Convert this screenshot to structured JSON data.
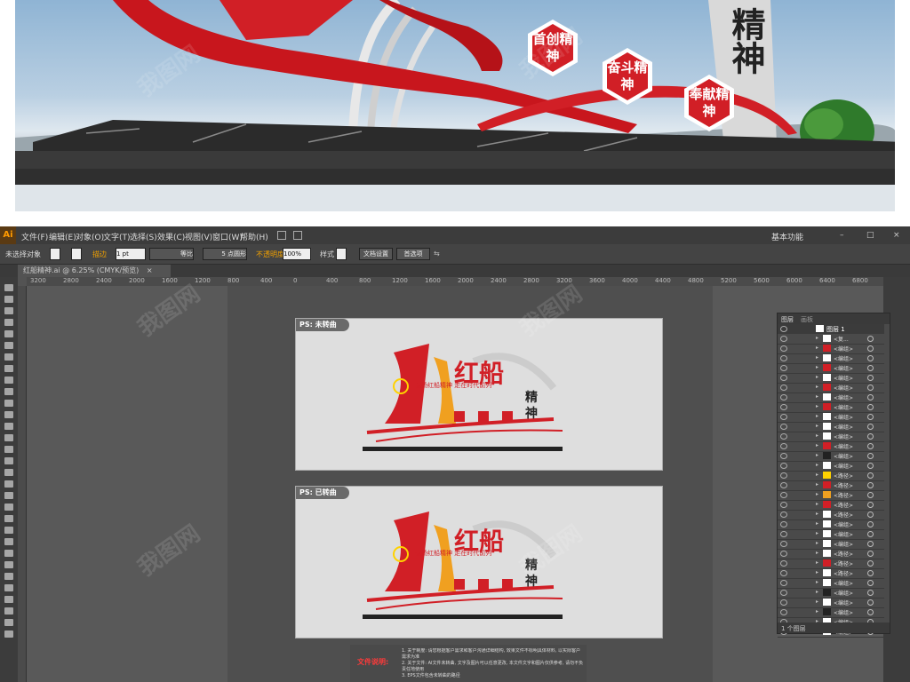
{
  "scene": {
    "hex_badges": [
      "首创精神",
      "奋斗精神",
      "奉献精神"
    ],
    "pillar_text": "精神",
    "colors": {
      "red": "#d11f26",
      "marble": "#2a2a2a"
    }
  },
  "app": {
    "logo": "Ai",
    "menus": [
      "文件(F)",
      "编辑(E)",
      "对象(O)",
      "文字(T)",
      "选择(S)",
      "效果(C)",
      "视图(V)",
      "窗口(W)",
      "帮助(H)"
    ],
    "workspace": "基本功能"
  },
  "control_bar": {
    "selection": "未选择对象",
    "stroke_label": "描边",
    "stroke_weight": "1 pt",
    "stroke_style": "等比",
    "brush": "5 点圆形",
    "opacity_label": "不透明度",
    "opacity": "100%",
    "style_label": "样式",
    "doc_setup": "文档设置",
    "preferences": "首选项"
  },
  "document_tab": "红船精神.ai @ 6.25% (CMYK/预览)",
  "ruler_ticks": [
    "3200",
    "2800",
    "2400",
    "2000",
    "1600",
    "1200",
    "800",
    "400",
    "0",
    "400",
    "800",
    "1200",
    "1600",
    "2000",
    "2400",
    "2800",
    "3200",
    "3600",
    "4000",
    "4400",
    "4800",
    "5200",
    "5600",
    "6000",
    "6400",
    "6800"
  ],
  "artboards": [
    {
      "label": "PS: 未转曲"
    },
    {
      "label": "PS: 已转曲"
    }
  ],
  "design_text": {
    "title_red": "红船",
    "subtitle": "精神",
    "slogan": "弘扬红船精神 走在时代前列"
  },
  "layers_panel": {
    "tabs": [
      "图层",
      "画板"
    ],
    "top_layer": "图层 1",
    "rows": [
      "<复...",
      "<编组>",
      "<编组>",
      "<编组>",
      "<编组>",
      "<编组>",
      "<编组>",
      "<编组>",
      "<编组>",
      "<编组>",
      "<编组>",
      "<编组>",
      "<编组>",
      "<编组>",
      "<路径>",
      "<路径>",
      "<路径>",
      "<路径>",
      "<路径>",
      "<编组>",
      "<编组>",
      "<编组>",
      "<路径>",
      "<路径>",
      "<路径>",
      "<编组>",
      "<编组>",
      "<编组>",
      "<编组>",
      "<编组>",
      "<编组>"
    ],
    "footer": "1 个图层"
  },
  "notes": {
    "heading": "文件说明:",
    "lines": [
      "1. 关于制度: 请您根据客户需求和客户沟通详细结构, 效果文件不标明具体材料, 以实际客户需求为准",
      "2. 关于文件: AI文件未转曲, 文字及图片可以任意更改, 本文件文字和图片仅供参考, 请勿不负责任地使用",
      "3. EPS文件包含未转曲的路径"
    ]
  },
  "watermark": "我图网"
}
